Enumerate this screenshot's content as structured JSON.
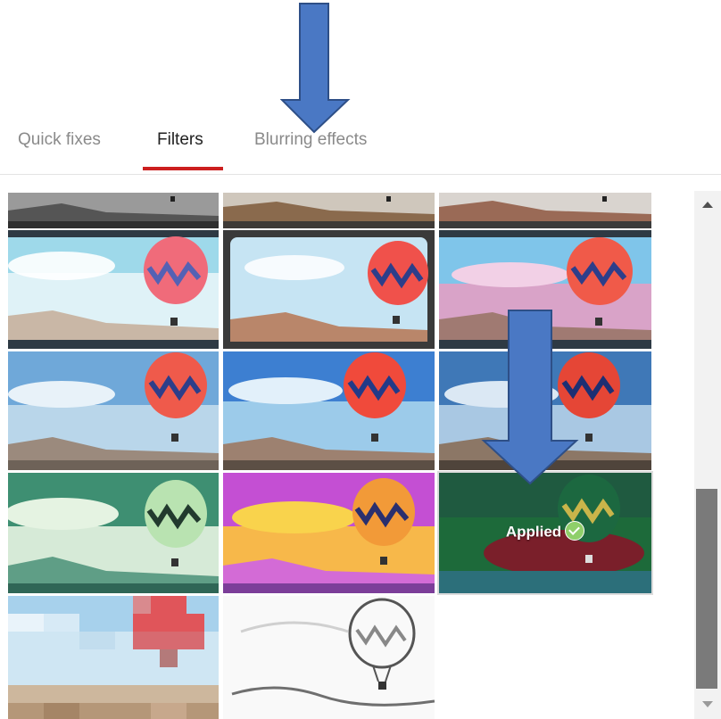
{
  "tabs": [
    {
      "label": "Quick fixes",
      "active": false
    },
    {
      "label": "Filters",
      "active": true
    },
    {
      "label": "Blurring effects",
      "active": false
    }
  ],
  "applied_label": "Applied",
  "colors": {
    "active_tab_underline": "#cc1f1f",
    "annotation_arrow_fill": "#4a78c4",
    "annotation_arrow_stroke": "#2e4f87"
  },
  "filters": [
    {
      "id": "mono",
      "row": 0,
      "col": 0
    },
    {
      "id": "vignette-warm",
      "row": 0,
      "col": 1
    },
    {
      "id": "vivid",
      "row": 0,
      "col": 2
    },
    {
      "id": "bright",
      "row": 1,
      "col": 0
    },
    {
      "id": "frame",
      "row": 1,
      "col": 1
    },
    {
      "id": "pink-sky",
      "row": 1,
      "col": 2
    },
    {
      "id": "cool",
      "row": 2,
      "col": 0
    },
    {
      "id": "deep-blue",
      "row": 2,
      "col": 1
    },
    {
      "id": "dark-sky",
      "row": 2,
      "col": 2
    },
    {
      "id": "green-tint",
      "row": 3,
      "col": 0
    },
    {
      "id": "sunset-pop",
      "row": 3,
      "col": 1
    },
    {
      "id": "inverted",
      "row": 3,
      "col": 2,
      "applied": true
    },
    {
      "id": "pixelate",
      "row": 4,
      "col": 0
    },
    {
      "id": "sketch",
      "row": 4,
      "col": 1
    }
  ]
}
